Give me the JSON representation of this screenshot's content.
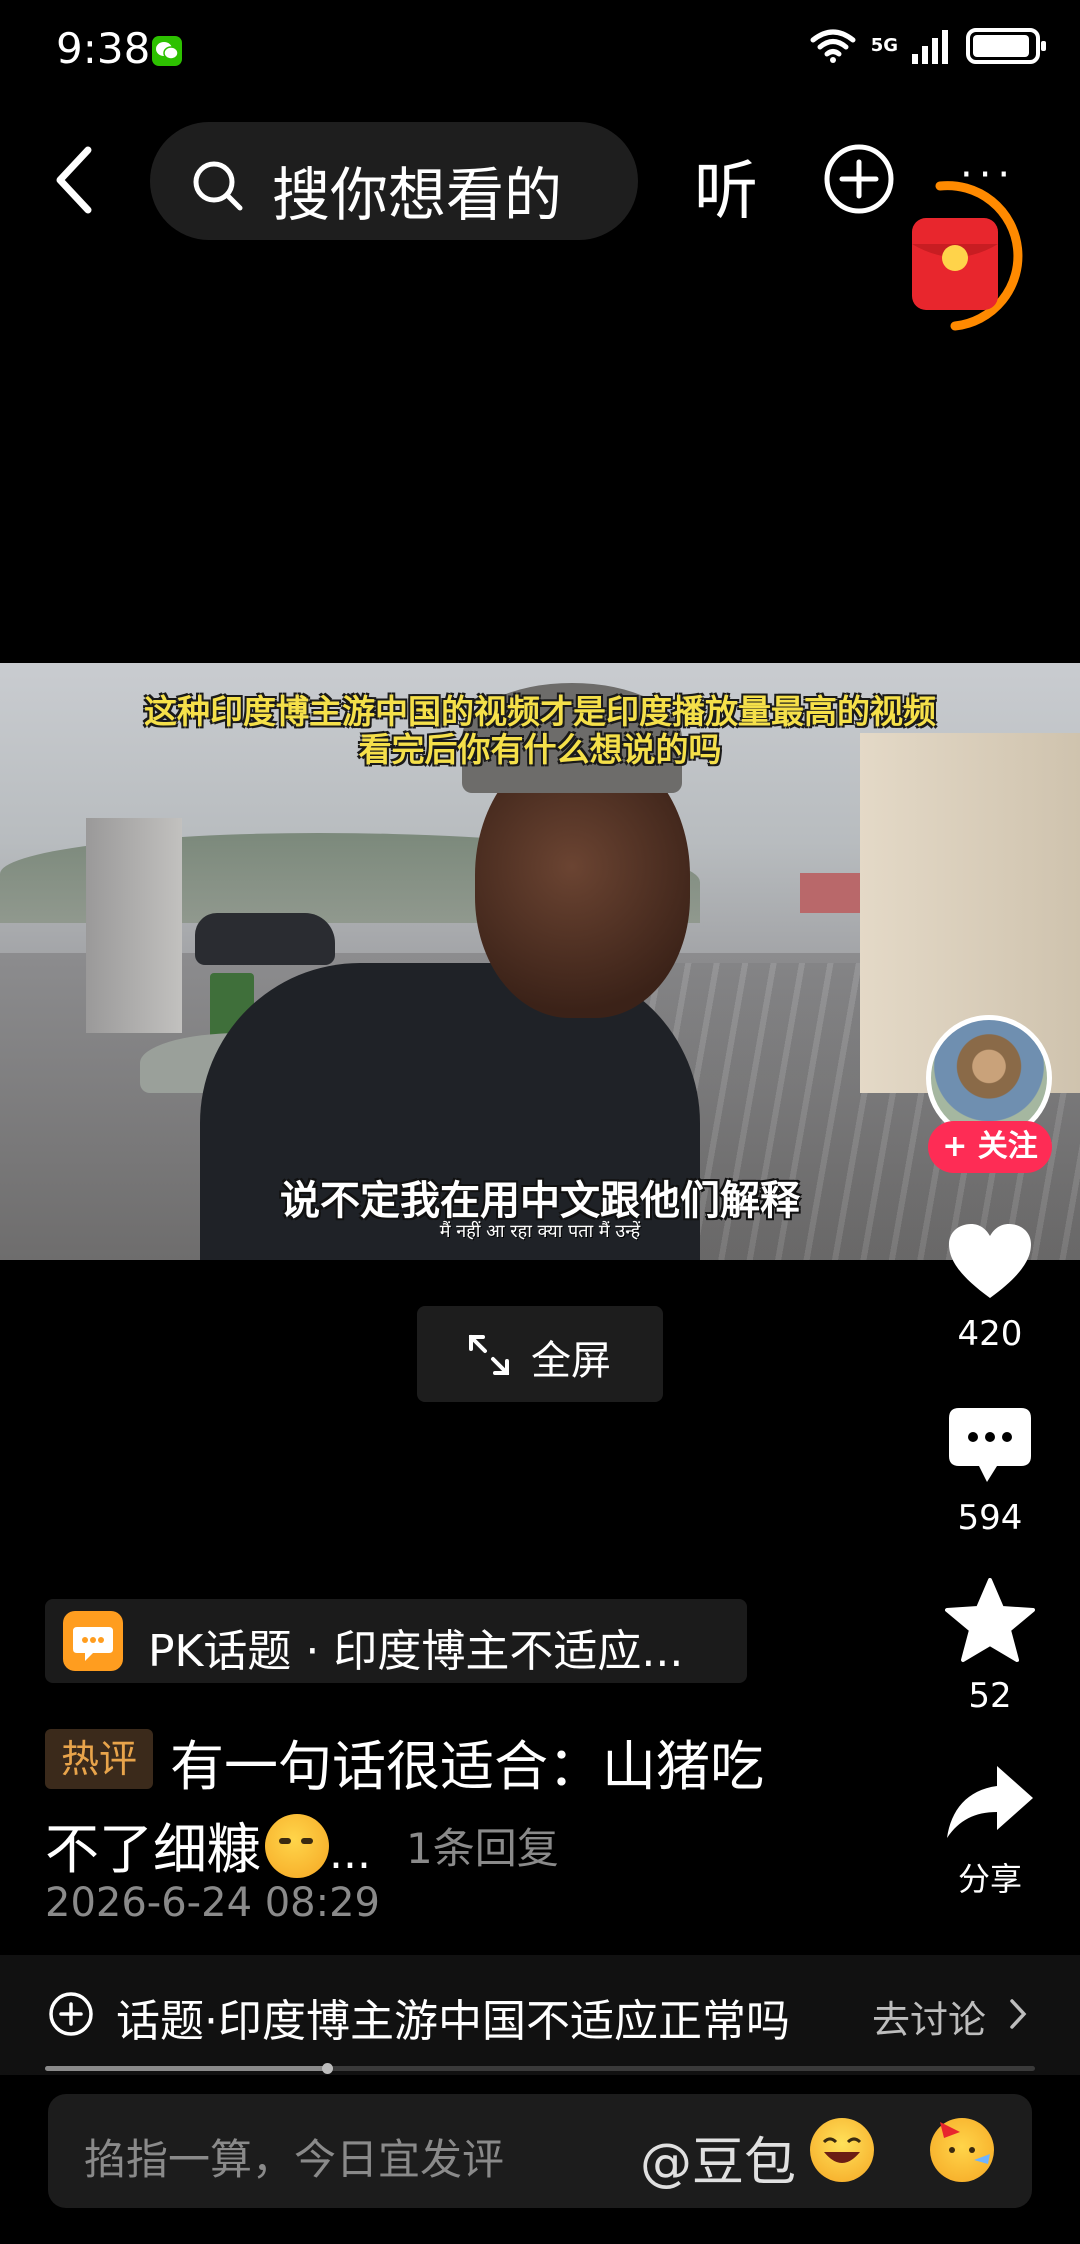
{
  "status_bar": {
    "time": "9:38",
    "network": "5G"
  },
  "top_bar": {
    "search_placeholder": "搜你想看的",
    "listen_label": "听"
  },
  "video": {
    "caption_top_line1": "这种印度博主游中国的视频才是印度播放量最高的视频",
    "caption_top_line2": "看完后你有什么想说的吗",
    "caption_bottom": "说不定我在用中文跟他们解释",
    "caption_hindi": "मैं नहीं आ रहा क्या पता मैं उन्हें"
  },
  "follow_label": "+ 关注",
  "fullscreen_label": "全屏",
  "actions": {
    "likes": "420",
    "comments": "594",
    "favorites": "52",
    "share_label": "分享"
  },
  "pk_topic": {
    "label": "PK话题 · 印度博主不适应..."
  },
  "hot_comment": {
    "badge": "热评",
    "line1": "有一句话很适合：山猪吃",
    "line2": "不了细糠",
    "ellipsis": "...",
    "reply_link": "1条回复",
    "date": "2026-6-24 08:29"
  },
  "topic_bar": {
    "label": "话题·印度博主游中国不适应正常吗",
    "discuss": "去讨论"
  },
  "progress": {
    "fraction": 0.285
  },
  "comment_input": {
    "placeholder": "掐指一算，今日宜发评",
    "mention": "@豆包"
  },
  "colors": {
    "accent_red": "#fe2c55",
    "hot_orange": "#e8a44b",
    "pk_orange": "#ff9d1f",
    "caption_yellow": "#f5e04a"
  },
  "icons": [
    "back-arrow-icon",
    "search-icon",
    "add-circle-icon",
    "more-icon",
    "red-packet-icon",
    "heart-icon",
    "comment-icon",
    "star-icon",
    "share-icon",
    "expand-icon",
    "plus-circle-icon",
    "chevron-right-icon",
    "laugh-emoji-icon",
    "party-emoji-icon"
  ]
}
